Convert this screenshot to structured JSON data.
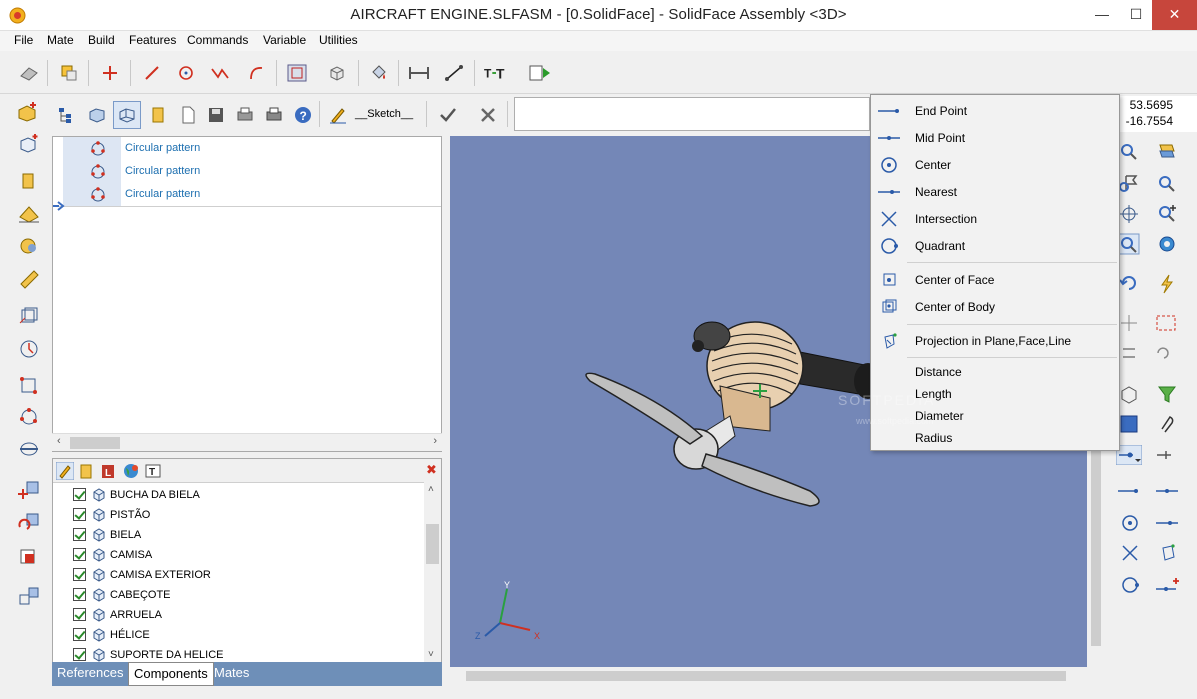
{
  "window": {
    "title": "AIRCRAFT ENGINE.SLFASM - [0.SolidFace] - SolidFace Assembly <3D>",
    "minimize": "—",
    "maximize": "☐",
    "close": "✕"
  },
  "menu": [
    "File",
    "Mate",
    "Build",
    "Features",
    "Commands",
    "Variable",
    "Utilities"
  ],
  "toolbar2": {
    "sketch_label": "__Sketch__"
  },
  "coords": {
    "x": "53.5695",
    "y": "-16.7554"
  },
  "tree": {
    "items": [
      {
        "label": "Circular pattern"
      },
      {
        "label": "Circular pattern"
      },
      {
        "label": "Circular pattern"
      }
    ]
  },
  "components": {
    "items": [
      {
        "name": "BUCHA DA BIELA"
      },
      {
        "name": "PISTÃO"
      },
      {
        "name": "BIELA"
      },
      {
        "name": "CAMISA"
      },
      {
        "name": "CAMISA EXTERIOR"
      },
      {
        "name": "CABEÇOTE"
      },
      {
        "name": "ARRUELA"
      },
      {
        "name": "HÉLICE"
      },
      {
        "name": "SUPORTE DA HELICE"
      }
    ]
  },
  "tabs": {
    "references": "References",
    "components": "Components",
    "mates": "Mates"
  },
  "snap_menu": {
    "end_point": "End Point",
    "mid_point": "Mid Point",
    "center": "Center",
    "nearest": "Nearest",
    "intersection": "Intersection",
    "quadrant": "Quadrant",
    "center_of_face": "Center of Face",
    "center_of_body": "Center of Body",
    "projection": "Projection in Plane,Face,Line",
    "distance": "Distance",
    "length": "Length",
    "diameter": "Diameter",
    "radius": "Radius"
  },
  "axes": {
    "x": "X",
    "y": "Y",
    "z": "Z"
  },
  "watermark": {
    "main": "SOFTPEDIA",
    "sub": "www.softpedia.com"
  },
  "colors": {
    "viewport_bg": "#7487b7",
    "tab_bar": "#6e8fb8",
    "tree_text": "#1d6fb0",
    "close_button": "#c7463c"
  }
}
